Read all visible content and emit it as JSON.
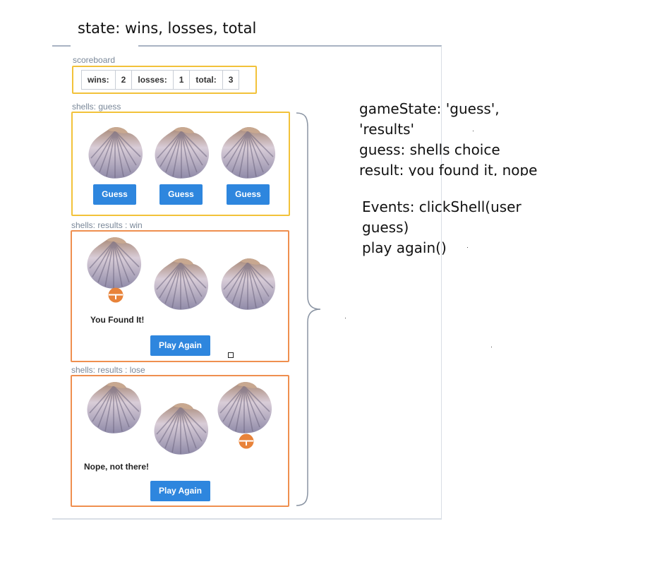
{
  "heading": "state: wins, losses, total",
  "scoreboard": {
    "label": "scoreboard",
    "wins_label": "wins:",
    "wins_value": "2",
    "losses_label": "losses:",
    "losses_value": "1",
    "total_label": "total:",
    "total_value": "3"
  },
  "panel_guess": {
    "label": "shells: guess",
    "buttons": [
      "Guess",
      "Guess",
      "Guess"
    ]
  },
  "panel_win": {
    "label": "shells: results : win",
    "message": "You Found It!",
    "button": "Play Again"
  },
  "panel_lose": {
    "label": "shells: results : lose",
    "message": "Nope, not there!",
    "button": "Play Again"
  },
  "notes": {
    "line1": "gameState: 'guess',",
    "line2": "'results'",
    "line3": "guess: shells choice",
    "line4": "result: you found it, nope",
    "events1": "Events: clickShell(user",
    "events2": "guess)",
    "events3": "play again()"
  },
  "colors": {
    "button_blue": "#2e86de",
    "border_yellow": "#f2c23a",
    "border_orange": "#ef8f4f",
    "marker_orange": "#e8833a"
  },
  "icons": {
    "shell": "seashell-icon",
    "marker": "pea-marker-icon"
  }
}
